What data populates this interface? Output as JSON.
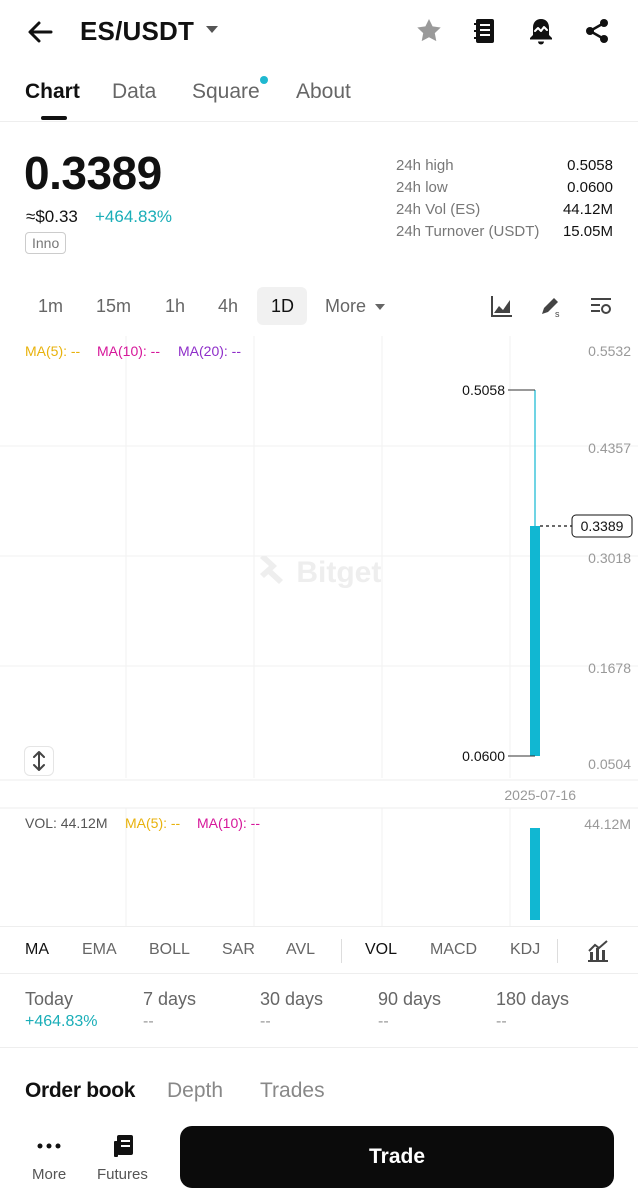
{
  "header": {
    "pair": "ES/USDT"
  },
  "tabs": [
    {
      "label": "Chart",
      "active": true
    },
    {
      "label": "Data"
    },
    {
      "label": "Square",
      "has_dot": true
    },
    {
      "label": "About"
    }
  ],
  "ticker": {
    "price": "0.3389",
    "usd_price": "≈$0.33",
    "change": "+464.83%",
    "tag": "Inno",
    "stats": [
      {
        "label": "24h high",
        "value": "0.5058"
      },
      {
        "label": "24h low",
        "value": "0.0600"
      },
      {
        "label": "24h Vol (ES)",
        "value": "44.12M"
      },
      {
        "label": "24h Turnover (USDT)",
        "value": "15.05M"
      }
    ]
  },
  "intervals": {
    "items": [
      "1m",
      "15m",
      "1h",
      "4h",
      "1D"
    ],
    "selected": "1D",
    "more_label": "More"
  },
  "chart": {
    "ma_labels": [
      {
        "text": "MA(5): --",
        "color": "#e8b20c"
      },
      {
        "text": "MA(10): --",
        "color": "#d6169a"
      },
      {
        "text": "MA(20): --",
        "color": "#8e2dc9"
      }
    ],
    "price_axis": [
      "0.5532",
      "0.4357",
      "0.3018",
      "0.1678",
      "0.0504"
    ],
    "current_price_label": "0.3389",
    "high_label": "0.5058",
    "low_label": "0.0600",
    "date_label": "2025-07-16",
    "watermark": "Bitget",
    "candle_color": "#11b7d2",
    "vol_label": "VOL: 44.12M",
    "vol_ma_labels": [
      {
        "text": "MA(5): --",
        "color": "#e8b20c"
      },
      {
        "text": "MA(10): --",
        "color": "#d6169a"
      }
    ],
    "vol_axis": "44.12M"
  },
  "chart_data": {
    "type": "candlestick",
    "candles": [
      {
        "date": "2025-07-16",
        "open": 0.06,
        "high": 0.5058,
        "low": 0.06,
        "close": 0.3389
      }
    ],
    "volume": [
      {
        "date": "2025-07-16",
        "value": "44.12M"
      }
    ],
    "ylim": [
      0.0504,
      0.5532
    ]
  },
  "indicators": {
    "main": [
      "MA",
      "EMA",
      "BOLL",
      "SAR",
      "AVL"
    ],
    "sub": [
      "VOL",
      "MACD",
      "KDJ"
    ]
  },
  "periods": [
    {
      "label": "Today",
      "value": "+464.83%"
    },
    {
      "label": "7 days",
      "value": "--"
    },
    {
      "label": "30 days",
      "value": "--"
    },
    {
      "label": "90 days",
      "value": "--"
    },
    {
      "label": "180 days",
      "value": "--"
    }
  ],
  "orderbook_tabs": [
    "Order book",
    "Depth",
    "Trades"
  ],
  "bottom": {
    "more_label": "More",
    "futures_label": "Futures",
    "trade_label": "Trade"
  }
}
